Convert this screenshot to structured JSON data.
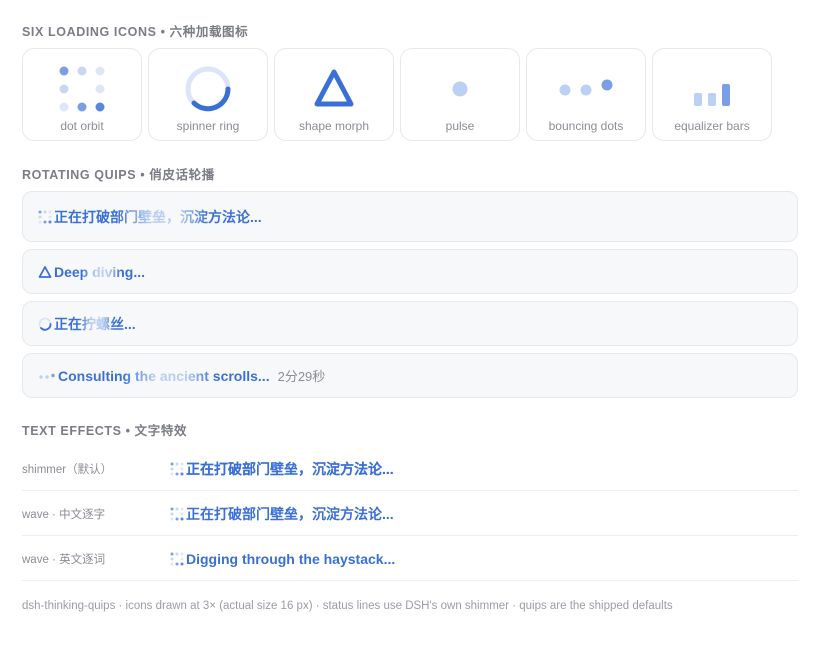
{
  "sections": {
    "icons_title": "SIX LOADING ICONS • 六种加载图标",
    "quips_title": "ROTATING QUIPS • 俏皮话轮播",
    "effects_title": "TEXT EFFECTS • 文字特效"
  },
  "icons": [
    {
      "label": "dot orbit",
      "icon": "dot-orbit-icon"
    },
    {
      "label": "spinner ring",
      "icon": "spinner-ring-icon"
    },
    {
      "label": "shape morph",
      "icon": "shape-morph-icon"
    },
    {
      "label": "pulse",
      "icon": "pulse-icon"
    },
    {
      "label": "bouncing dots",
      "icon": "bouncing-dots-icon"
    },
    {
      "label": "equalizer bars",
      "icon": "equalizer-bars-icon"
    }
  ],
  "quips": [
    {
      "text": "正在打破部门壁垒，沉淀方法论...",
      "icon": "dot-orbit-icon"
    },
    {
      "text": "Deep diving...",
      "icon": "shape-morph-icon"
    },
    {
      "text": "正在拧螺丝...",
      "icon": "spinner-ring-icon"
    },
    {
      "text": "Consulting the ancient scrolls...",
      "icon": "bouncing-dots-icon",
      "elapsed": "2分29秒"
    }
  ],
  "effects": [
    {
      "label": "shimmer（默认）",
      "text": "正在打破部门壁垒，沉淀方法论..."
    },
    {
      "label": "wave · 中文逐字",
      "text": "正在打破部门壁垒，沉淀方法论..."
    },
    {
      "label": "wave · 英文逐词",
      "text": "Digging through the haystack..."
    }
  ],
  "footer": "dsh-thinking-quips · icons drawn at 3× (actual size 16 px) · status lines use DSH's own shimmer · quips are the shipped defaults",
  "colors": {
    "accent": "#3a6fd8",
    "accent_light": "#b8cdf1",
    "card_border": "#e6e8ec",
    "quip_bg": "#f7f8fa"
  }
}
